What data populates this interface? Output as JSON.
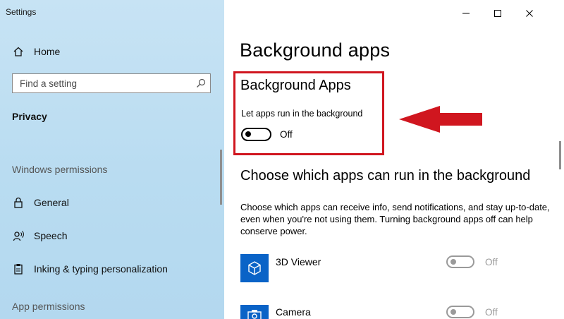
{
  "window": {
    "title": "Settings"
  },
  "sidebar": {
    "home_label": "Home",
    "search_placeholder": "Find a setting",
    "category": "Privacy",
    "section_windows_permissions": "Windows permissions",
    "items": [
      {
        "label": "General",
        "icon": "lock-icon"
      },
      {
        "label": "Speech",
        "icon": "speech-icon"
      },
      {
        "label": "Inking & typing personalization",
        "icon": "clipboard-icon"
      }
    ],
    "section_app_permissions": "App permissions"
  },
  "main": {
    "page_title": "Background apps",
    "background_apps": {
      "heading": "Background Apps",
      "description": "Let apps run in the background",
      "toggle_state": "Off"
    },
    "choose": {
      "heading": "Choose which apps can run in the background",
      "description": "Choose which apps can receive info, send notifications, and stay up-to-date, even when you're not using them. Turning background apps off can help conserve power."
    },
    "apps": [
      {
        "name": "3D Viewer",
        "state": "Off",
        "icon": "cube-icon"
      },
      {
        "name": "Camera",
        "state": "Off",
        "icon": "camera-icon"
      }
    ]
  },
  "colors": {
    "sidebar_bg": "#c7e3f4",
    "accent_tile": "#0a63c7",
    "annotation_red": "#d0161f"
  }
}
